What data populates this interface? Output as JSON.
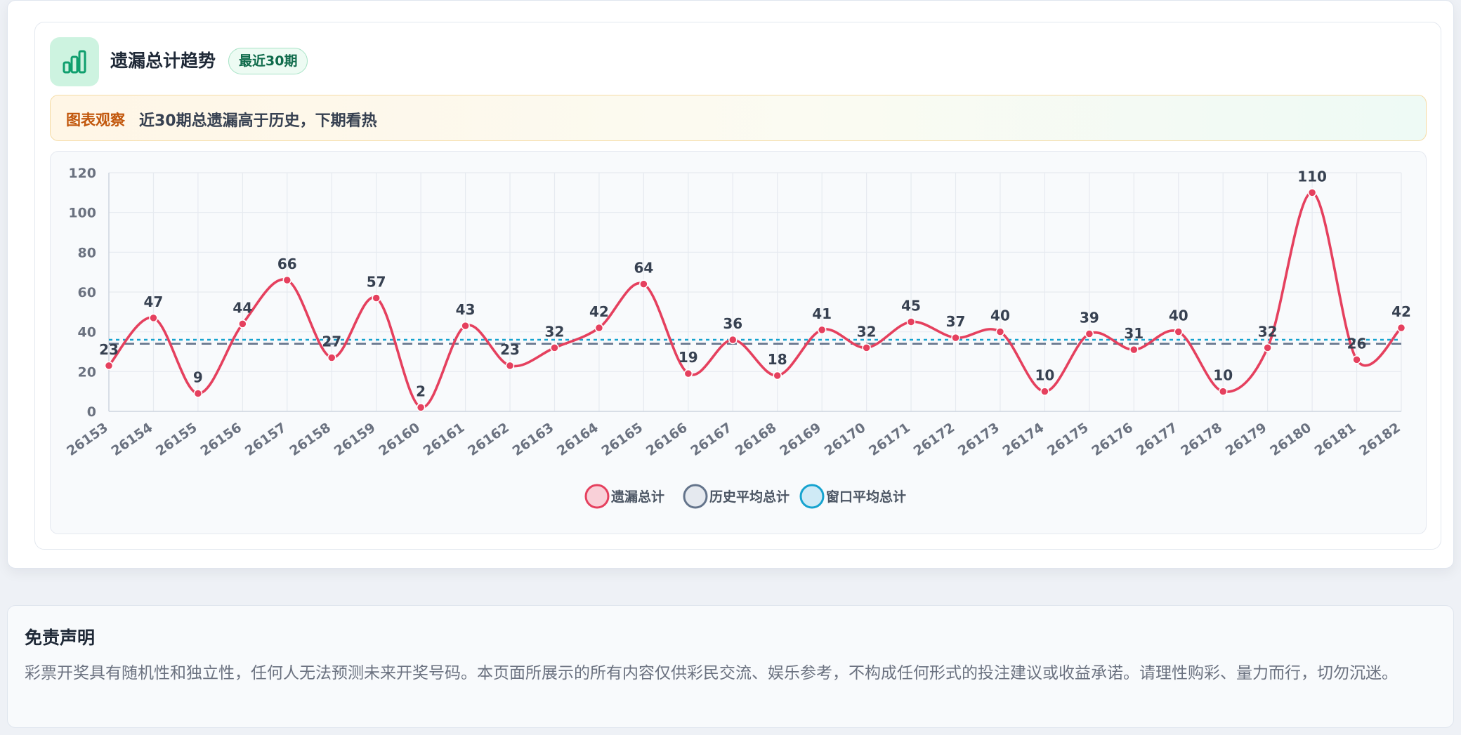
{
  "header": {
    "title": "遗漏总计趋势",
    "badge": "最近30期",
    "icon": "bar-chart-icon"
  },
  "insight": {
    "label": "图表观察",
    "text": "近30期总遗漏高于历史，下期看热"
  },
  "colors": {
    "series_line": "#e5405e",
    "history_avg": "#64748b",
    "window_avg": "#16a3cf",
    "accent_green": "#0f9f6e",
    "insight_label": "#c2570c"
  },
  "chart_data": {
    "type": "line",
    "x": [
      "26153",
      "26154",
      "26155",
      "26156",
      "26157",
      "26158",
      "26159",
      "26160",
      "26161",
      "26162",
      "26163",
      "26164",
      "26165",
      "26166",
      "26167",
      "26168",
      "26169",
      "26170",
      "26171",
      "26172",
      "26173",
      "26174",
      "26175",
      "26176",
      "26177",
      "26178",
      "26179",
      "26180",
      "26181",
      "26182"
    ],
    "series": [
      {
        "name": "遗漏总计",
        "values": [
          23,
          47,
          9,
          44,
          66,
          27,
          57,
          2,
          43,
          23,
          32,
          42,
          64,
          19,
          36,
          18,
          41,
          32,
          45,
          37,
          40,
          10,
          39,
          31,
          40,
          10,
          32,
          110,
          26,
          42
        ],
        "color": "#e5405e",
        "smooth": true,
        "data_labels": true
      }
    ],
    "reference_lines": [
      {
        "name": "历史平均总计",
        "value": 34,
        "style": "dashed",
        "color": "#64748b"
      },
      {
        "name": "窗口平均总计",
        "value": 36,
        "style": "dotted",
        "color": "#16a3cf"
      }
    ],
    "y_ticks": [
      0,
      20,
      40,
      60,
      80,
      100,
      120
    ],
    "ylim": [
      0,
      120
    ],
    "grid": true,
    "legend_position": "bottom-center",
    "x_tick_rotation": "diagonal"
  },
  "disclaimer": {
    "title": "免责声明",
    "text": "彩票开奖具有随机性和独立性，任何人无法预测未来开奖号码。本页面所展示的所有内容仅供彩民交流、娱乐参考，不构成任何形式的投注建议或收益承诺。请理性购彩、量力而行，切勿沉迷。"
  }
}
